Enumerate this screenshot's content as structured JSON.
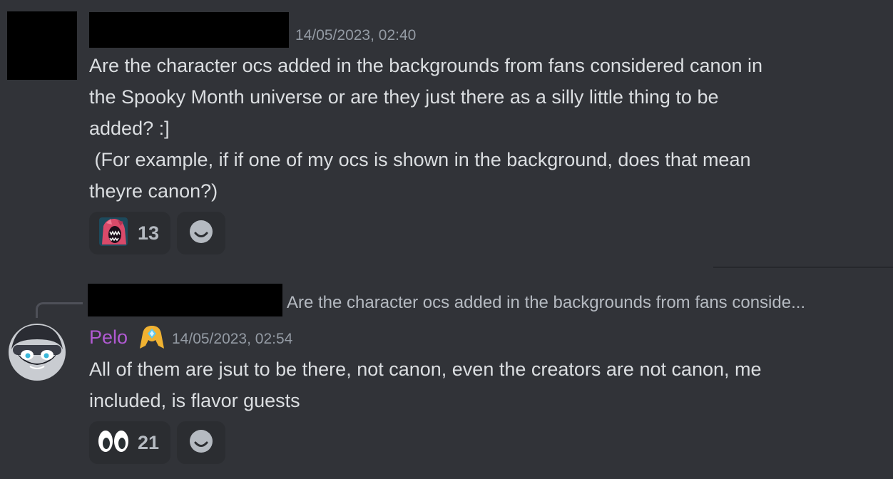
{
  "message_1": {
    "timestamp": "14/05/2023, 02:40",
    "lines": [
      "Are the character ocs added in the backgrounds from fans considered canon in",
      "the Spooky Month universe or are they just there as a silly little thing to be",
      "added? :]",
      " (For example, if if one of my ocs is shown in the background, does that mean",
      "theyre canon?)"
    ],
    "reaction": {
      "icon": "character-emoji-icon",
      "count": "13"
    },
    "add_reaction_icon": "smiley-add-reaction-icon"
  },
  "message_2": {
    "reply_preview": "Are the character ocs added in the backgrounds from fans conside...",
    "username": "Pelo",
    "username_color": "#b15ad3",
    "badge_icon": "role-badge-icon",
    "timestamp": "14/05/2023, 02:54",
    "lines": [
      "All of them are jsut to be there, not canon, even the creators are not canon, me",
      "included, is flavor guests"
    ],
    "reaction": {
      "icon": "eyes-emoji-icon",
      "count": "21"
    },
    "add_reaction_icon": "smiley-add-reaction-icon"
  },
  "colors": {
    "background": "#313338",
    "text": "#dbdee1",
    "muted": "#949ba4",
    "reaction_bg": "#2b2d31"
  }
}
